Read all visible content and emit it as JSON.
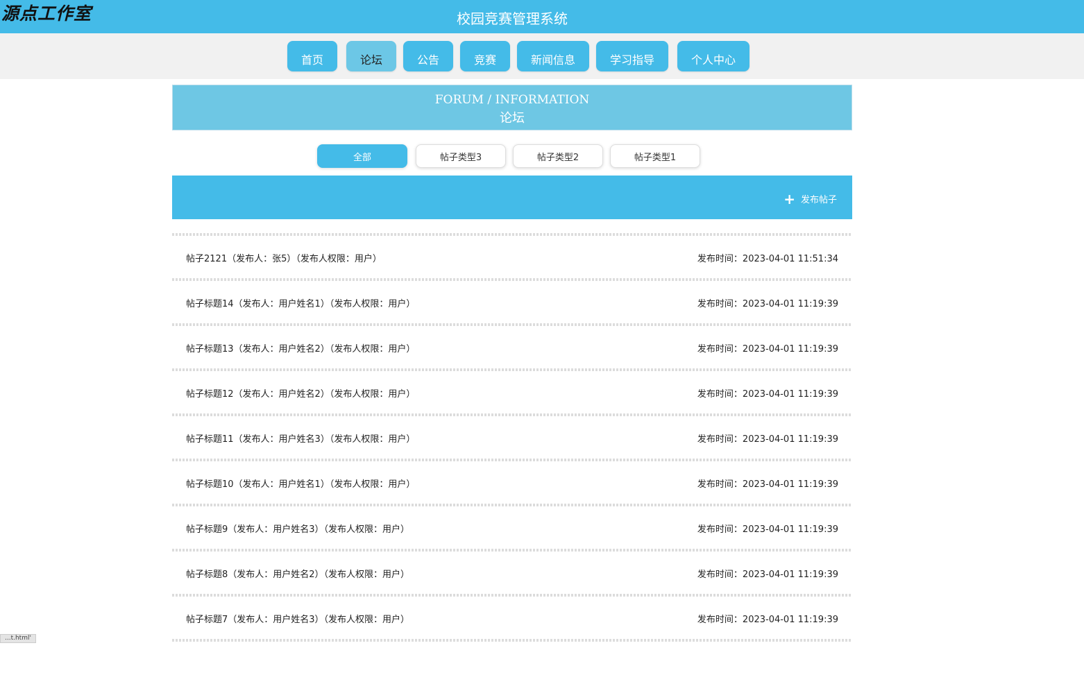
{
  "watermark": "源点工作室",
  "header": {
    "title": "校园竞赛管理系统"
  },
  "nav": [
    {
      "label": "首页"
    },
    {
      "label": "论坛"
    },
    {
      "label": "公告"
    },
    {
      "label": "竞赛"
    },
    {
      "label": "新闻信息"
    },
    {
      "label": "学习指导"
    },
    {
      "label": "个人中心"
    }
  ],
  "nav_active": "论坛",
  "banner": {
    "en": "FORUM / INFORMATION",
    "cn": "论坛"
  },
  "filters": [
    {
      "label": "全部",
      "active": true
    },
    {
      "label": "帖子类型3"
    },
    {
      "label": "帖子类型2"
    },
    {
      "label": "帖子类型1"
    }
  ],
  "actions": {
    "add_post": "发布帖子"
  },
  "posts": [
    {
      "title": "帖子2121（发布人：张5）（发布人权限：用户）",
      "time": "发布时间：2023-04-01 11:51:34"
    },
    {
      "title": "帖子标题14（发布人：用户姓名1）（发布人权限：用户）",
      "time": "发布时间：2023-04-01 11:19:39"
    },
    {
      "title": "帖子标题13（发布人：用户姓名2）（发布人权限：用户）",
      "time": "发布时间：2023-04-01 11:19:39"
    },
    {
      "title": "帖子标题12（发布人：用户姓名2）（发布人权限：用户）",
      "time": "发布时间：2023-04-01 11:19:39"
    },
    {
      "title": "帖子标题11（发布人：用户姓名3）（发布人权限：用户）",
      "time": "发布时间：2023-04-01 11:19:39"
    },
    {
      "title": "帖子标题10（发布人：用户姓名1）（发布人权限：用户）",
      "time": "发布时间：2023-04-01 11:19:39"
    },
    {
      "title": "帖子标题9（发布人：用户姓名3）（发布人权限：用户）",
      "time": "发布时间：2023-04-01 11:19:39"
    },
    {
      "title": "帖子标题8（发布人：用户姓名2）（发布人权限：用户）",
      "time": "发布时间：2023-04-01 11:19:39"
    },
    {
      "title": "帖子标题7（发布人：用户姓名3）（发布人权限：用户）",
      "time": "发布时间：2023-04-01 11:19:39"
    }
  ],
  "status_tip": "...t.html'"
}
